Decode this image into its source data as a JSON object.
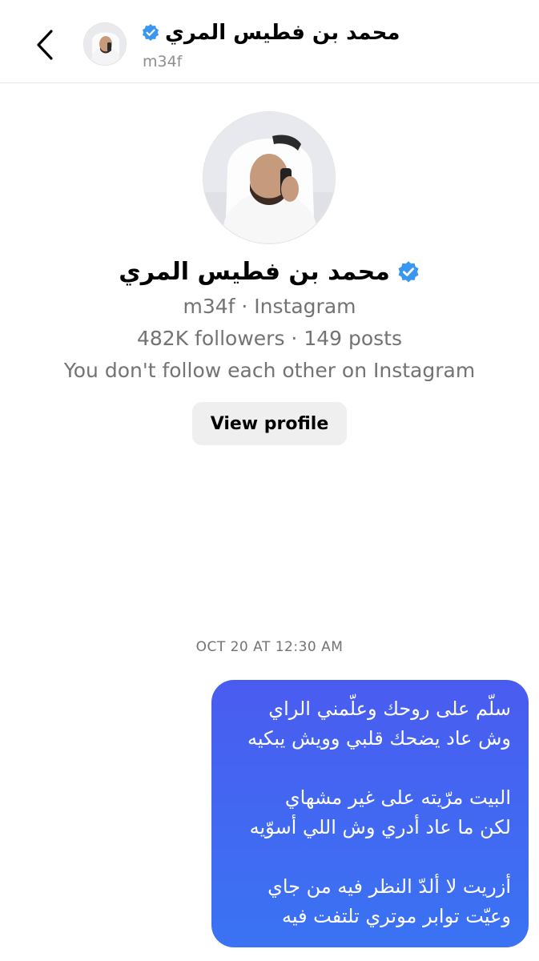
{
  "header": {
    "name": "محمد بن فطيس المري",
    "username": "m34f",
    "back_icon": "chevron-left-icon",
    "verified_icon": "verified-badge-icon"
  },
  "profile": {
    "name": "محمد بن فطيس المري",
    "source_line": "m34f · Instagram",
    "stats_line": "482K followers · 149 posts",
    "relation_line": "You don't follow each other on Instagram",
    "view_profile_label": "View profile"
  },
  "conversation": {
    "timestamp": "OCT 20 AT 12:30 AM",
    "message_lines": [
      "سلّم على روحك وعلّمني الراي",
      "وش عاد يضحك قلبي وويش يبكيه",
      "",
      "البيت مرّيته على غير مشهاي",
      "لكن ما عاد أدري وش اللي أسوّيه",
      "",
      "أزريت لا ألدّ النظر فيه من جاي",
      "وعيّت توابر موتري تلتفت فيه"
    ]
  },
  "colors": {
    "bubble_top": "#4a5cf0",
    "bubble_bottom": "#3a73f3",
    "verified_blue": "#3897f0",
    "muted_text": "#737373",
    "button_bg": "#efefef"
  }
}
